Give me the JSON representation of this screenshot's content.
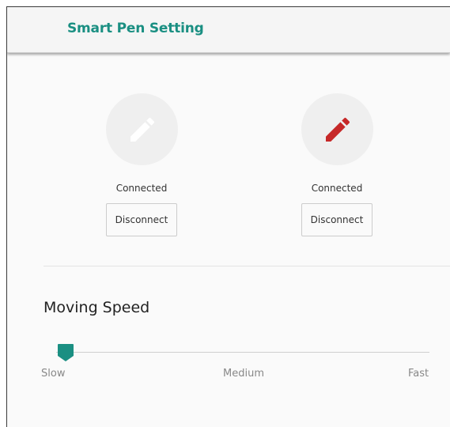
{
  "header": {
    "title": "Smart Pen Setting"
  },
  "pens": [
    {
      "icon": "pen-icon",
      "icon_color": "#ffffff",
      "status": "Connected",
      "button_label": "Disconnect"
    },
    {
      "icon": "pen-icon",
      "icon_color": "#c62828",
      "status": "Connected",
      "button_label": "Disconnect"
    }
  ],
  "moving_speed": {
    "title": "Moving Speed",
    "labels": [
      "Slow",
      "Medium",
      "Fast"
    ],
    "selected": "Slow",
    "value_fraction": 0,
    "accent_color": "#1a8f82"
  }
}
